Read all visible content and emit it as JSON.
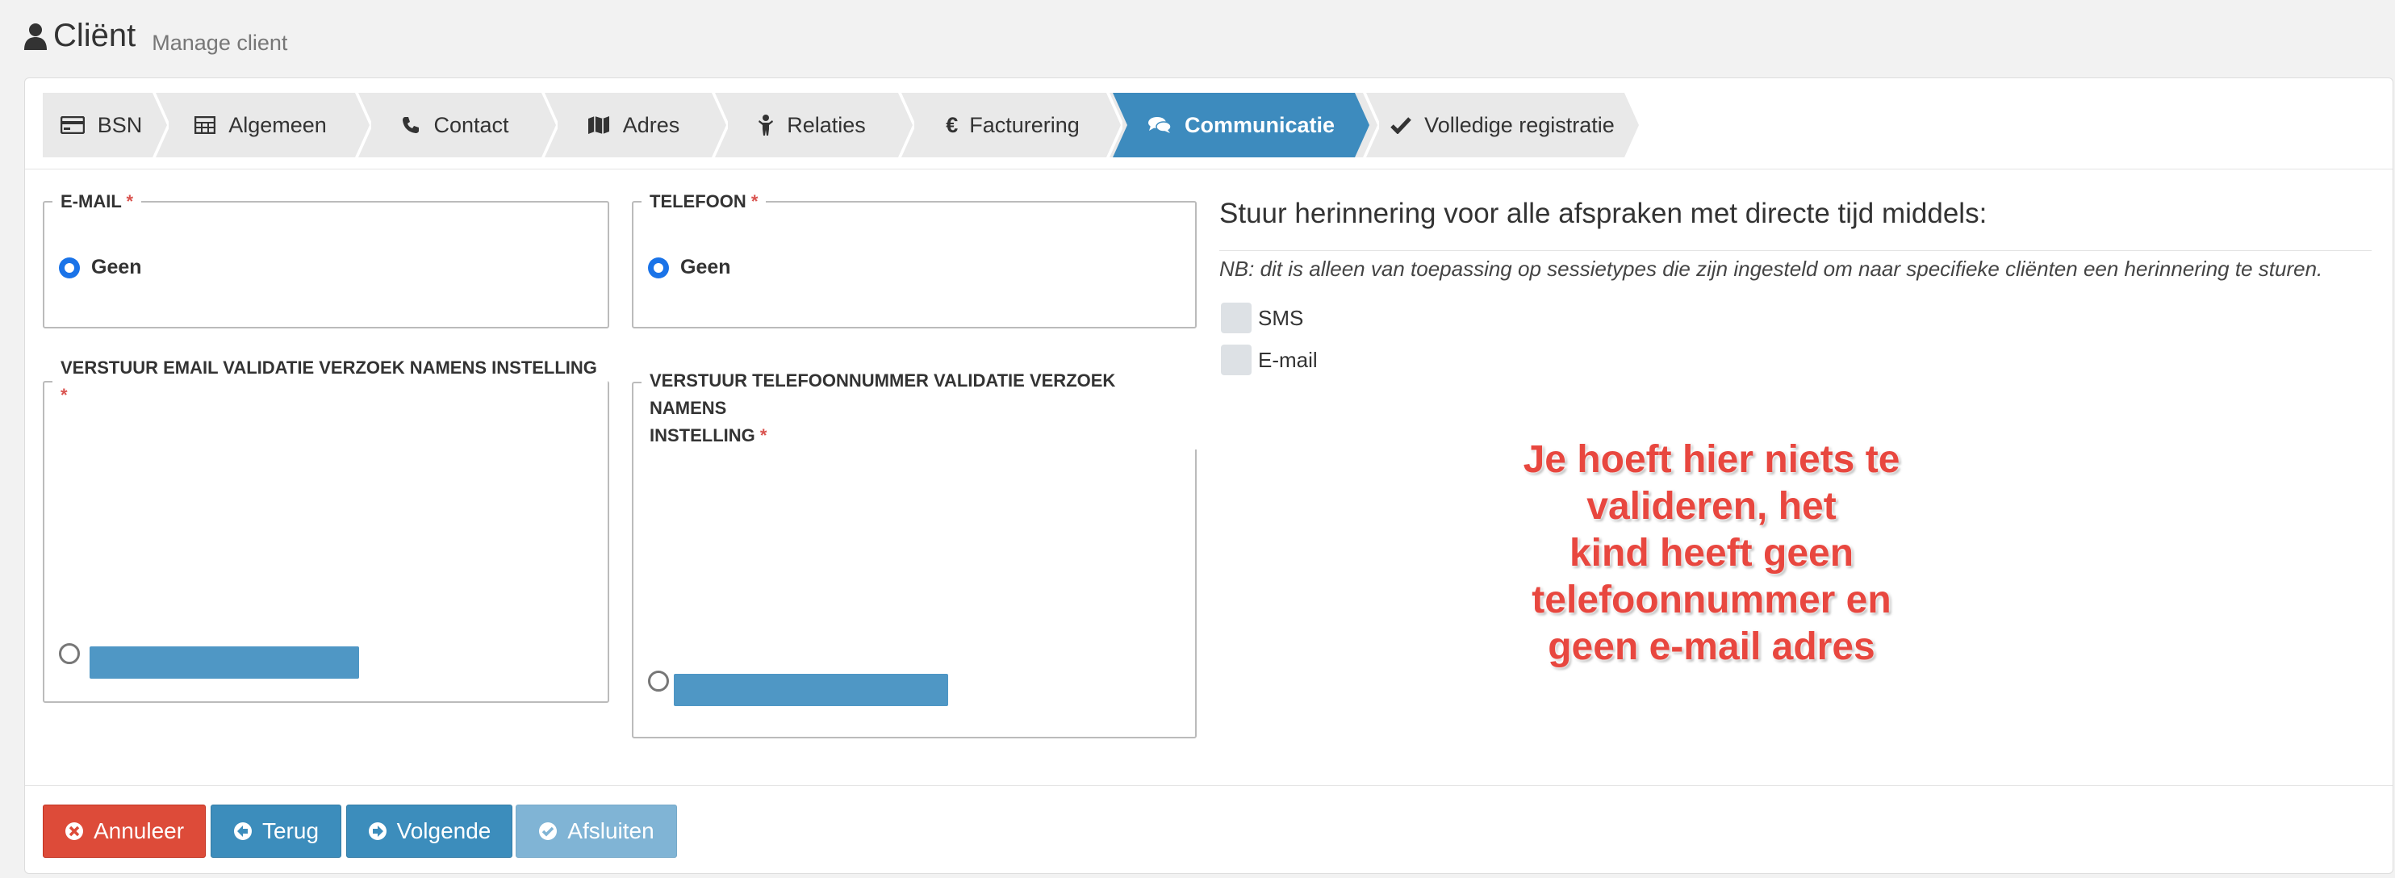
{
  "header": {
    "title": "Cliënt",
    "subtitle": "Manage client"
  },
  "wizard": {
    "steps": [
      {
        "label": "BSN",
        "icon": "credit-card-icon"
      },
      {
        "label": "Algemeen",
        "icon": "table-icon"
      },
      {
        "label": "Contact",
        "icon": "phone-icon"
      },
      {
        "label": "Adres",
        "icon": "map-icon"
      },
      {
        "label": "Relaties",
        "icon": "child-icon"
      },
      {
        "label": "Facturering",
        "icon": "euro-icon"
      },
      {
        "label": "Communicatie",
        "icon": "comments-icon",
        "active": true
      },
      {
        "label": "Volledige registratie",
        "icon": "check-icon"
      }
    ]
  },
  "email": {
    "legend": "E-MAIL",
    "required": "*",
    "option": "Geen"
  },
  "phone": {
    "legend": "TELEFOON",
    "required": "*",
    "option": "Geen"
  },
  "email_validation": {
    "legend": "VERSTUUR EMAIL VALIDATIE VERZOEK NAMENS INSTELLING",
    "required": "*"
  },
  "phone_validation": {
    "legend_line1": "VERSTUUR TELEFOONNUMMER VALIDATIE VERZOEK NAMENS",
    "legend_line2": "INSTELLING",
    "required": "*"
  },
  "reminder": {
    "title": "Stuur herinnering voor alle afspraken met directe tijd middels:",
    "note": "NB: dit is alleen van toepassing op sessietypes die zijn ingesteld om naar specifieke cliënten een herinnering te sturen.",
    "options": [
      "SMS",
      "E-mail"
    ]
  },
  "annotation": {
    "line1": "Je hoeft hier niets te valideren, het",
    "line2": "kind heeft geen telefoonnummer en",
    "line3": "geen e-mail adres"
  },
  "buttons": {
    "cancel": "Annuleer",
    "back": "Terug",
    "next": "Volgende",
    "finish": "Afsluiten"
  },
  "colors": {
    "primary": "#3c8dbc",
    "danger": "#dd4b39",
    "required": "#d9534f",
    "annotation": "#e8473f"
  }
}
